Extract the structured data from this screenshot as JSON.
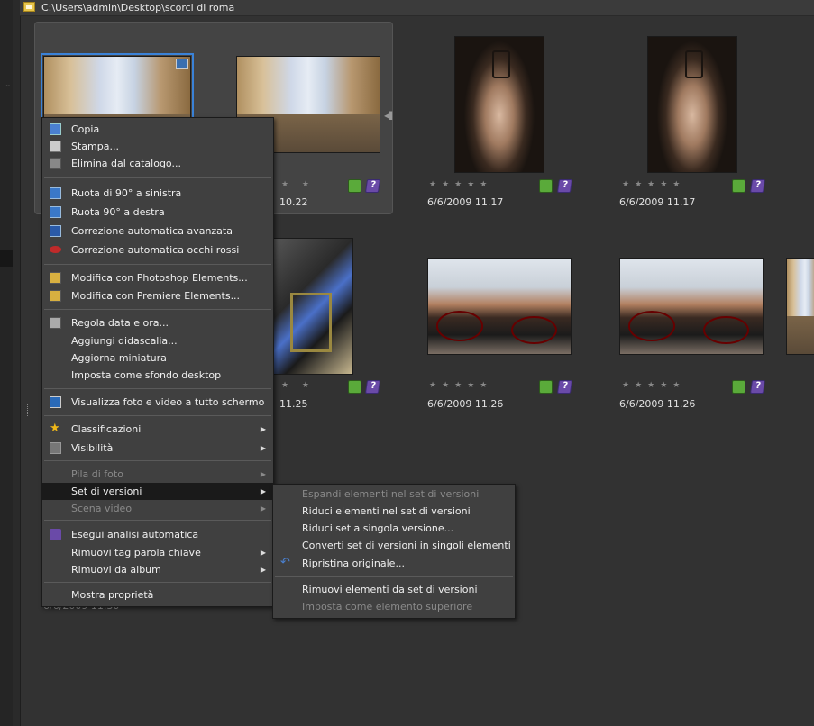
{
  "pathbar": {
    "path": "C:\\Users\\admin\\Desktop\\scorci di roma"
  },
  "left": {
    "dots": "..."
  },
  "thumbs": [
    {
      "stars": "★★★★★",
      "date": ""
    },
    {
      "stars": "★ ★",
      "date": "10.22"
    },
    {
      "stars": "★★★★★",
      "date": "6/6/2009 11.17"
    },
    {
      "stars": "★★★★★",
      "date": "6/6/2009 11.17"
    },
    {
      "stars": "★ ★",
      "date": "11.25"
    },
    {
      "stars": "★★★★★",
      "date": "6/6/2009 11.26"
    },
    {
      "stars": "★★★★★",
      "date": "6/6/2009 11.26"
    },
    {
      "date": "6/6/2009 11.30"
    }
  ],
  "context_menu": {
    "items": [
      {
        "label": "Copia",
        "icon": "copy-icon"
      },
      {
        "label": "Stampa...",
        "icon": "print-icon"
      },
      {
        "label": "Elimina dal catalogo...",
        "icon": "trash-icon"
      },
      {
        "label": "Ruota di 90° a sinistra",
        "icon": "rotate-left-icon"
      },
      {
        "label": "Ruota 90° a destra",
        "icon": "rotate-right-icon"
      },
      {
        "label": "Correzione automatica avanzata",
        "icon": "magic-wand-icon"
      },
      {
        "label": "Correzione automatica occhi rossi",
        "icon": "red-eye-icon"
      },
      {
        "label": "Modifica con Photoshop Elements...",
        "icon": "edit-photo-icon"
      },
      {
        "label": "Modifica con Premiere Elements...",
        "icon": "edit-video-icon"
      },
      {
        "label": "Regola data e ora...",
        "icon": "calendar-icon"
      },
      {
        "label": "Aggiungi didascalia..."
      },
      {
        "label": "Aggiorna miniatura"
      },
      {
        "label": "Imposta come sfondo desktop"
      },
      {
        "label": "Visualizza foto e video a tutto schermo",
        "icon": "fullscreen-icon"
      },
      {
        "label": "Classificazioni",
        "icon": "star-icon",
        "submenu": true
      },
      {
        "label": "Visibilità",
        "icon": "visibility-icon",
        "submenu": true
      },
      {
        "label": "Pila di foto",
        "disabled": true,
        "submenu": true
      },
      {
        "label": "Set di versioni",
        "highlight": true,
        "submenu": true
      },
      {
        "label": "Scena video",
        "disabled": true,
        "submenu": true
      },
      {
        "label": "Esegui analisi automatica",
        "icon": "tag-icon"
      },
      {
        "label": "Rimuovi tag parola chiave",
        "submenu": true
      },
      {
        "label": "Rimuovi da album",
        "submenu": true
      },
      {
        "label": "Mostra proprietà"
      }
    ]
  },
  "sub_menu": {
    "items": [
      {
        "label": "Espandi elementi nel set di versioni",
        "disabled": true
      },
      {
        "label": "Riduci elementi nel set di versioni"
      },
      {
        "label": "Riduci set a singola versione..."
      },
      {
        "label": "Converti set di versioni in singoli elementi"
      },
      {
        "label": "Ripristina originale...",
        "icon": "undo-icon"
      },
      {
        "label": "Rimuovi elementi da set di versioni"
      },
      {
        "label": "Imposta come elemento superiore",
        "disabled": true
      }
    ]
  },
  "colors": {
    "accent": "#3a82d8",
    "menu_bg": "#404040",
    "highlight": "#1a1a1a"
  }
}
